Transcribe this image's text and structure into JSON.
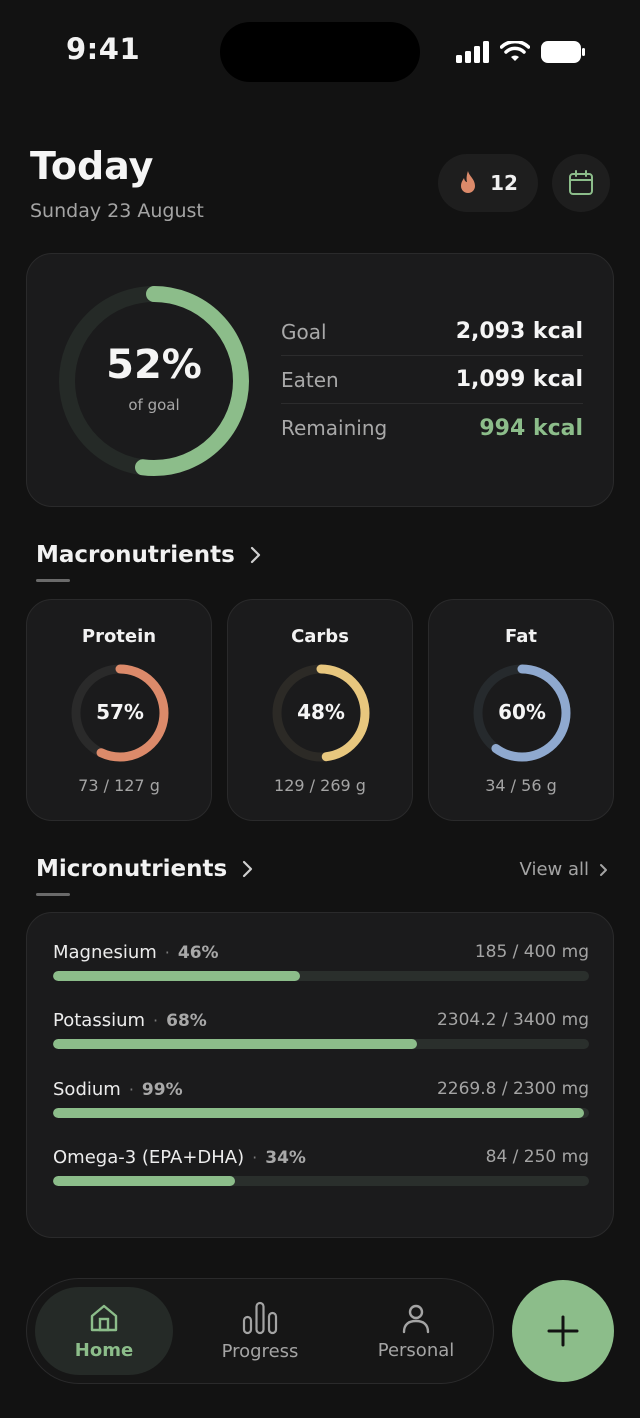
{
  "status_bar": {
    "time": "9:41"
  },
  "header": {
    "title": "Today",
    "date": "Sunday 23 August",
    "streak_count": "12",
    "streak_icon": "flame-icon",
    "calendar_icon": "calendar-icon"
  },
  "summary": {
    "percent_label": "52%",
    "percent_value": 52,
    "percent_sub": "of goal",
    "rows": [
      {
        "label": "Goal",
        "value": "2,093 kcal"
      },
      {
        "label": "Eaten",
        "value": "1,099 kcal"
      },
      {
        "label": "Remaining",
        "value": "994 kcal"
      }
    ]
  },
  "macros": {
    "title": "Macronutrients",
    "items": [
      {
        "name": "Protein",
        "percent_label": "57%",
        "percent": 57,
        "amount": "73 / 127 g",
        "color": "#dc8a6a"
      },
      {
        "name": "Carbs",
        "percent_label": "48%",
        "percent": 48,
        "amount": "129 / 269 g",
        "color": "#e8c77e"
      },
      {
        "name": "Fat",
        "percent_label": "60%",
        "percent": 60,
        "amount": "34 / 56 g",
        "color": "#8fa9cf"
      }
    ]
  },
  "micros": {
    "title": "Micronutrients",
    "view_all": "View all",
    "items": [
      {
        "name": "Magnesium",
        "percent_label": "46%",
        "amount": "185 / 400 mg",
        "fill": 46
      },
      {
        "name": "Potassium",
        "percent_label": "68%",
        "amount": "2304.2 / 3400 mg",
        "fill": 68
      },
      {
        "name": "Sodium",
        "percent_label": "99%",
        "amount": "2269.8 / 2300 mg",
        "fill": 99
      },
      {
        "name": "Omega-3 (EPA+DHA)",
        "percent_label": "34%",
        "amount": "84 / 250 mg",
        "fill": 34
      }
    ]
  },
  "nav": {
    "items": [
      {
        "label": "Home",
        "icon": "home-icon"
      },
      {
        "label": "Progress",
        "icon": "chart-icon"
      },
      {
        "label": "Personal",
        "icon": "person-icon"
      }
    ],
    "add_icon": "plus-icon"
  },
  "colors": {
    "accent": "#8cbd8a",
    "background": "#121212",
    "card": "#1b1b1c"
  }
}
